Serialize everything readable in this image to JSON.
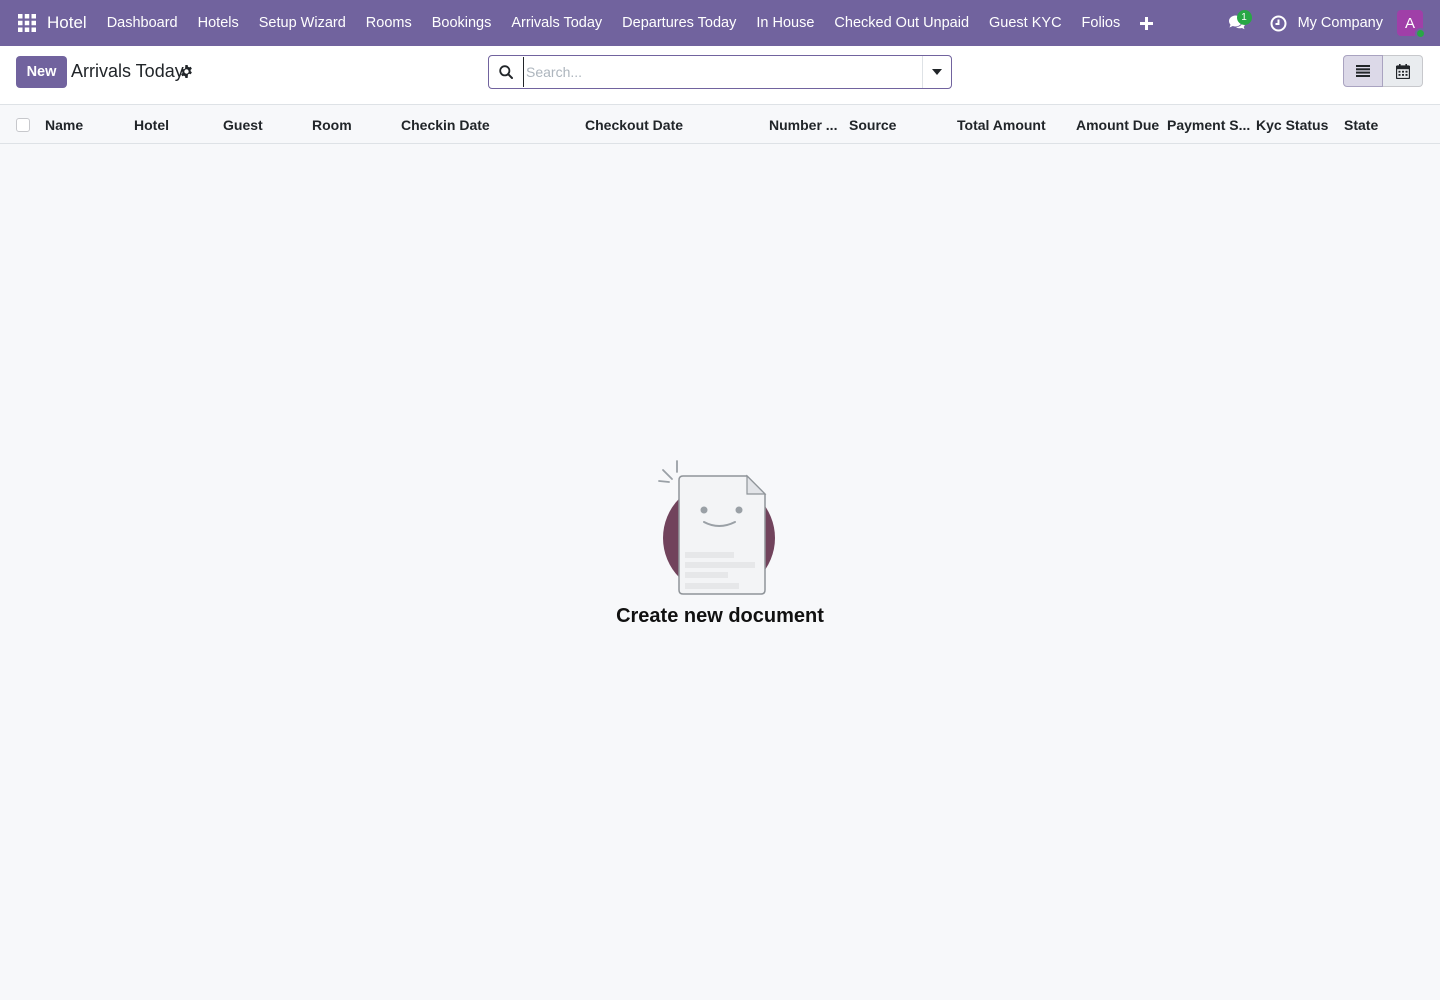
{
  "navbar": {
    "brand": "Hotel",
    "menu": [
      "Dashboard",
      "Hotels",
      "Setup Wizard",
      "Rooms",
      "Bookings",
      "Arrivals Today",
      "Departures Today",
      "In House",
      "Checked Out Unpaid",
      "Guest KYC",
      "Folios"
    ],
    "chat_count": "1",
    "company": "My Company",
    "avatar_letter": "A",
    "color": "#71639e"
  },
  "control": {
    "new_label": "New",
    "breadcrumb": "Arrivals Today",
    "search_placeholder": "Search..."
  },
  "list": {
    "columns": [
      "Name",
      "Hotel",
      "Guest",
      "Room",
      "Checkin Date",
      "Checkout Date",
      "Number ...",
      "Source",
      "Total Amount",
      "Amount Due",
      "Payment S...",
      "Kyc Status",
      "State"
    ]
  },
  "empty_state": {
    "title": "Create new document"
  },
  "icons": [
    "apps-grid-icon",
    "plus-icon",
    "chat-icon",
    "clock-icon",
    "gear-icon",
    "search-icon",
    "caret-down-icon",
    "list-view-icon",
    "calendar-view-icon"
  ]
}
